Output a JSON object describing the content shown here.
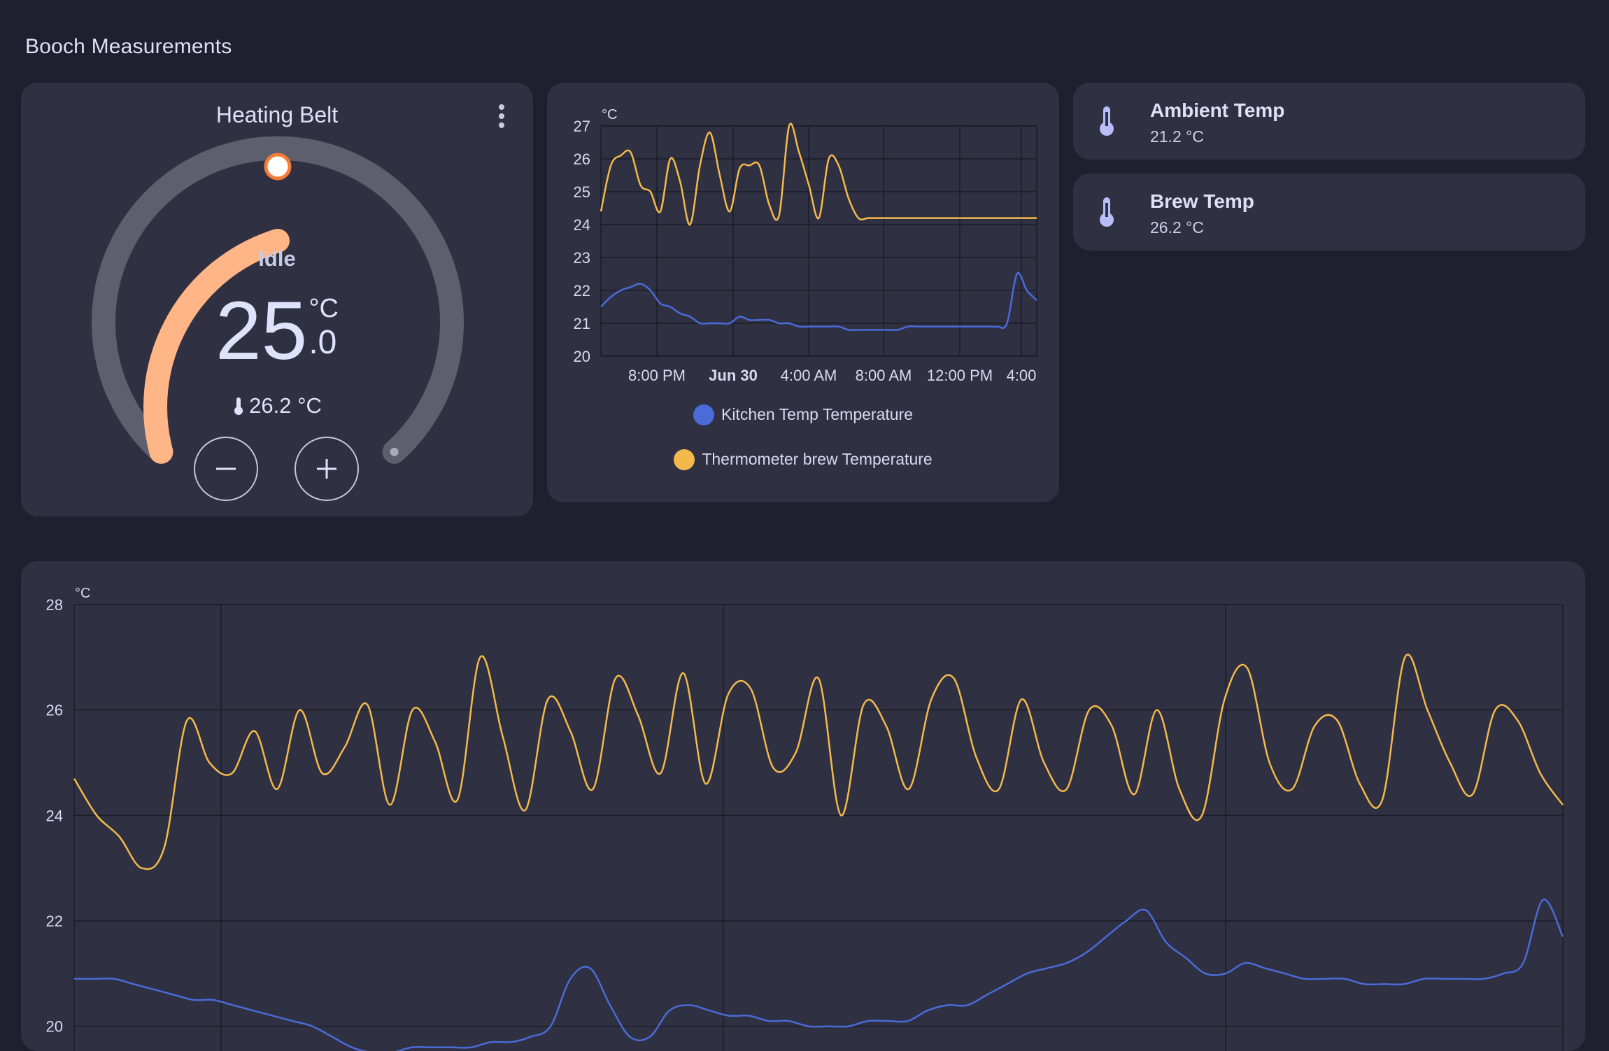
{
  "section_title": "Booch Measurements",
  "thermostat": {
    "title": "Heating Belt",
    "state": "Idle",
    "target_int": "25",
    "target_unit": "°C",
    "target_dec": ".0",
    "current": "26.2 °C",
    "minus_label": "−",
    "plus_label": "+",
    "icons": [
      "dots-vertical-icon",
      "thermometer-icon",
      "minus-icon",
      "plus-icon"
    ],
    "colors": {
      "active_arc": "#ffb586",
      "inactive_arc": "#5e5f6d",
      "handle_ring": "#f57c37"
    }
  },
  "entities": [
    {
      "name": "Ambient Temp",
      "state": "21.2 °C",
      "icon": "thermometer-icon"
    },
    {
      "name": "Brew Temp",
      "state": "26.2 °C",
      "icon": "thermometer-icon"
    }
  ],
  "chart_data": [
    {
      "type": "line",
      "unit": "°C",
      "ylim": [
        20,
        27
      ],
      "yticks": [
        "20",
        "21",
        "22",
        "23",
        "24",
        "25",
        "26",
        "27"
      ],
      "xticks": [
        "8:00 PM",
        "Jun 30",
        "4:00 AM",
        "8:00 AM",
        "12:00 PM",
        "4:00"
      ],
      "grid": true,
      "legend": "bottom",
      "colors": {
        "kitchen": "#4a6bd8",
        "brew": "#f3b94c"
      },
      "series": [
        {
          "name": "Kitchen Temp Temperature",
          "color": "#4a6bd8",
          "x": [
            0,
            0.5,
            1,
            1.5,
            2,
            2.5,
            3,
            3.5,
            4,
            4.5,
            5,
            5.5,
            6,
            6.5,
            7,
            7.5,
            8,
            8.5,
            9,
            9.5,
            10,
            10.5,
            11,
            11.5,
            12,
            12.5,
            13,
            13.5,
            14,
            14.5,
            15,
            15.5,
            16,
            16.5,
            17,
            17.5,
            18,
            18.5,
            19,
            19.5,
            20,
            20.5,
            21,
            21.5,
            22,
            22.5,
            23,
            23.5,
            24,
            24.5,
            25,
            25.5,
            26,
            26.5,
            27,
            27.5,
            28,
            28.5,
            29
          ],
          "values": [
            21.5,
            21.8,
            22.0,
            22.1,
            22.2,
            22.0,
            21.6,
            21.5,
            21.3,
            21.2,
            21.0,
            21.0,
            21.0,
            21.0,
            21.2,
            21.1,
            21.1,
            21.1,
            21.0,
            21.0,
            20.9,
            20.9,
            20.9,
            20.9,
            20.9,
            20.8,
            20.8,
            20.8,
            20.8,
            20.8,
            20.8,
            20.9,
            20.9,
            20.9,
            20.9,
            20.9,
            20.9,
            20.9,
            20.9,
            20.9,
            20.9,
            21.0,
            22.5,
            22.0,
            21.7,
            21.7,
            21.7,
            21.7,
            21.7,
            21.7,
            21.7,
            21.7,
            21.7,
            21.7,
            21.7,
            21.7,
            21.7,
            21.7,
            21.7
          ]
        },
        {
          "name": "Thermometer brew Temperature",
          "color": "#f3b94c",
          "x": [
            0,
            0.5,
            1,
            1.5,
            2,
            2.5,
            3,
            3.5,
            4,
            4.5,
            5,
            5.5,
            6,
            6.5,
            7,
            7.5,
            8,
            8.5,
            9,
            9.5,
            10,
            10.5,
            11,
            11.5,
            12,
            12.5,
            13,
            13.5,
            14,
            14.5,
            15,
            15.5,
            16,
            16.5,
            17,
            17.5,
            18,
            18.5,
            19,
            19.5,
            20,
            20.5,
            21,
            21.5,
            22
          ],
          "values": [
            24.4,
            25.8,
            26.1,
            26.2,
            25.2,
            25.0,
            24.4,
            26.0,
            25.3,
            24.0,
            25.8,
            26.8,
            25.5,
            24.4,
            25.7,
            25.8,
            25.8,
            24.6,
            24.3,
            27.0,
            26.2,
            25.2,
            24.2,
            26.0,
            25.8,
            24.8,
            24.2,
            24.2,
            24.2,
            24.2,
            24.2,
            24.2,
            24.2,
            24.2,
            24.2,
            24.2,
            24.2,
            24.2,
            24.2,
            24.2,
            24.2,
            24.2,
            24.2,
            24.2,
            24.2
          ]
        }
      ]
    },
    {
      "type": "line",
      "unit": "°C",
      "ylim": [
        19,
        28
      ],
      "yticks": [
        "20",
        "22",
        "24",
        "26",
        "28"
      ],
      "grid": true,
      "series": [
        {
          "name": "Kitchen Temp Temperature",
          "color": "#4a6bd8",
          "values": [
            20.9,
            20.9,
            20.9,
            20.8,
            20.7,
            20.6,
            20.5,
            20.5,
            20.4,
            20.3,
            20.2,
            20.1,
            20.0,
            19.8,
            19.6,
            19.5,
            19.5,
            19.6,
            19.6,
            19.6,
            19.6,
            19.7,
            19.7,
            19.8,
            20.0,
            20.9,
            21.1,
            20.4,
            19.8,
            19.8,
            20.3,
            20.4,
            20.3,
            20.2,
            20.2,
            20.1,
            20.1,
            20.0,
            20.0,
            20.0,
            20.1,
            20.1,
            20.1,
            20.3,
            20.4,
            20.4,
            20.6,
            20.8,
            21.0,
            21.1,
            21.2,
            21.4,
            21.7,
            22.0,
            22.2,
            21.6,
            21.3,
            21.0,
            21.0,
            21.2,
            21.1,
            21.0,
            20.9,
            20.9,
            20.9,
            20.8,
            20.8,
            20.8,
            20.9,
            20.9,
            20.9,
            20.9,
            21.0,
            21.2,
            22.4,
            21.7
          ]
        },
        {
          "name": "Thermometer brew Temperature",
          "color": "#f3b94c",
          "values": [
            24.7,
            24.0,
            23.6,
            23.0,
            23.4,
            25.8,
            25.0,
            24.8,
            25.6,
            24.5,
            26.0,
            24.8,
            25.3,
            26.1,
            24.2,
            26.0,
            25.4,
            24.3,
            27.0,
            25.5,
            24.1,
            26.2,
            25.6,
            24.5,
            26.6,
            25.9,
            24.8,
            26.7,
            24.6,
            26.3,
            26.4,
            24.9,
            25.2,
            26.6,
            24.0,
            26.1,
            25.7,
            24.5,
            26.2,
            26.6,
            25.1,
            24.5,
            26.2,
            25.0,
            24.5,
            26.0,
            25.7,
            24.4,
            26.0,
            24.5,
            24.0,
            26.2,
            26.8,
            25.0,
            24.5,
            25.7,
            25.8,
            24.6,
            24.3,
            27.0,
            26.0,
            25.0,
            24.4,
            26.0,
            25.8,
            24.8,
            24.2
          ]
        }
      ]
    }
  ]
}
